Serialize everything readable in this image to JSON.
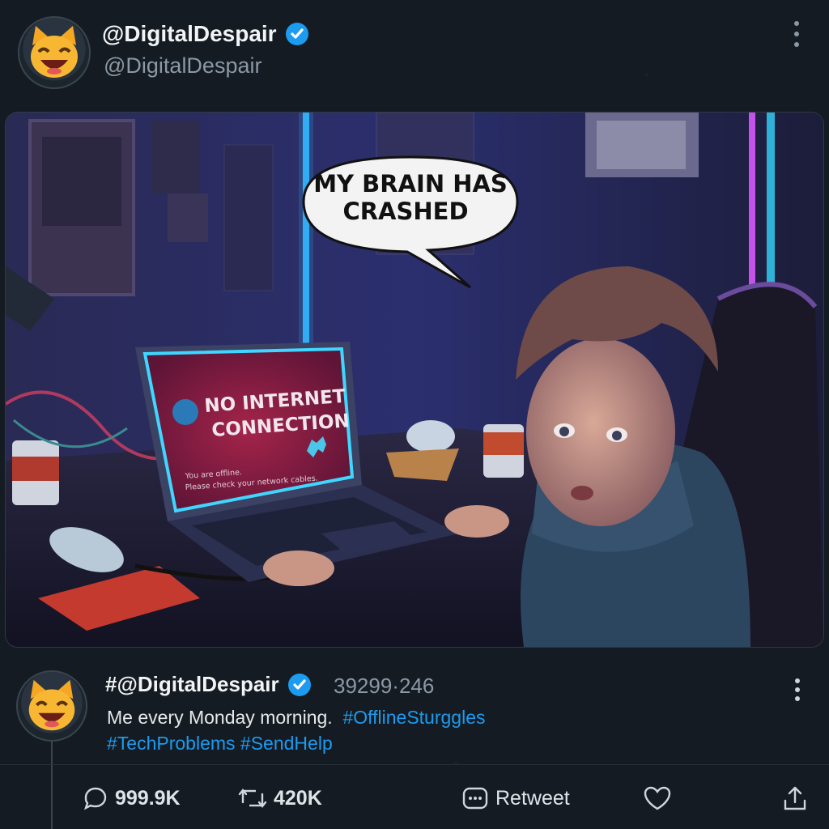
{
  "header": {
    "display_name": "@DigitalDespair",
    "handle": "@DigitalDespair",
    "verified": true
  },
  "media": {
    "speech_bubble_line1": "MY BRAIN HAS",
    "speech_bubble_line2": "CRASHED",
    "screen_title_line1": "NO INTERNET",
    "screen_title_line2": "CONNECTION",
    "screen_sub_line1": "You are offline.",
    "screen_sub_line2": "Please check your network cables."
  },
  "tweet": {
    "name": "#@DigitalDespair",
    "meta": "39299·246",
    "text": "Me every Monday morning.",
    "hashtags": [
      "#OfflineSturggles",
      "#TechProblems",
      "#SendHelp"
    ]
  },
  "actions": {
    "replies": "999.9K",
    "reposts": "420K",
    "retweet_label": "Retweet"
  },
  "colors": {
    "background": "#141b22",
    "accent": "#1d9bf0",
    "muted": "#8b98a5"
  },
  "icons": [
    "cat-emoji-avatar",
    "verified-badge-icon",
    "more-icon",
    "reply-icon",
    "repost-icon",
    "retweet-icon",
    "like-icon",
    "share-icon"
  ]
}
